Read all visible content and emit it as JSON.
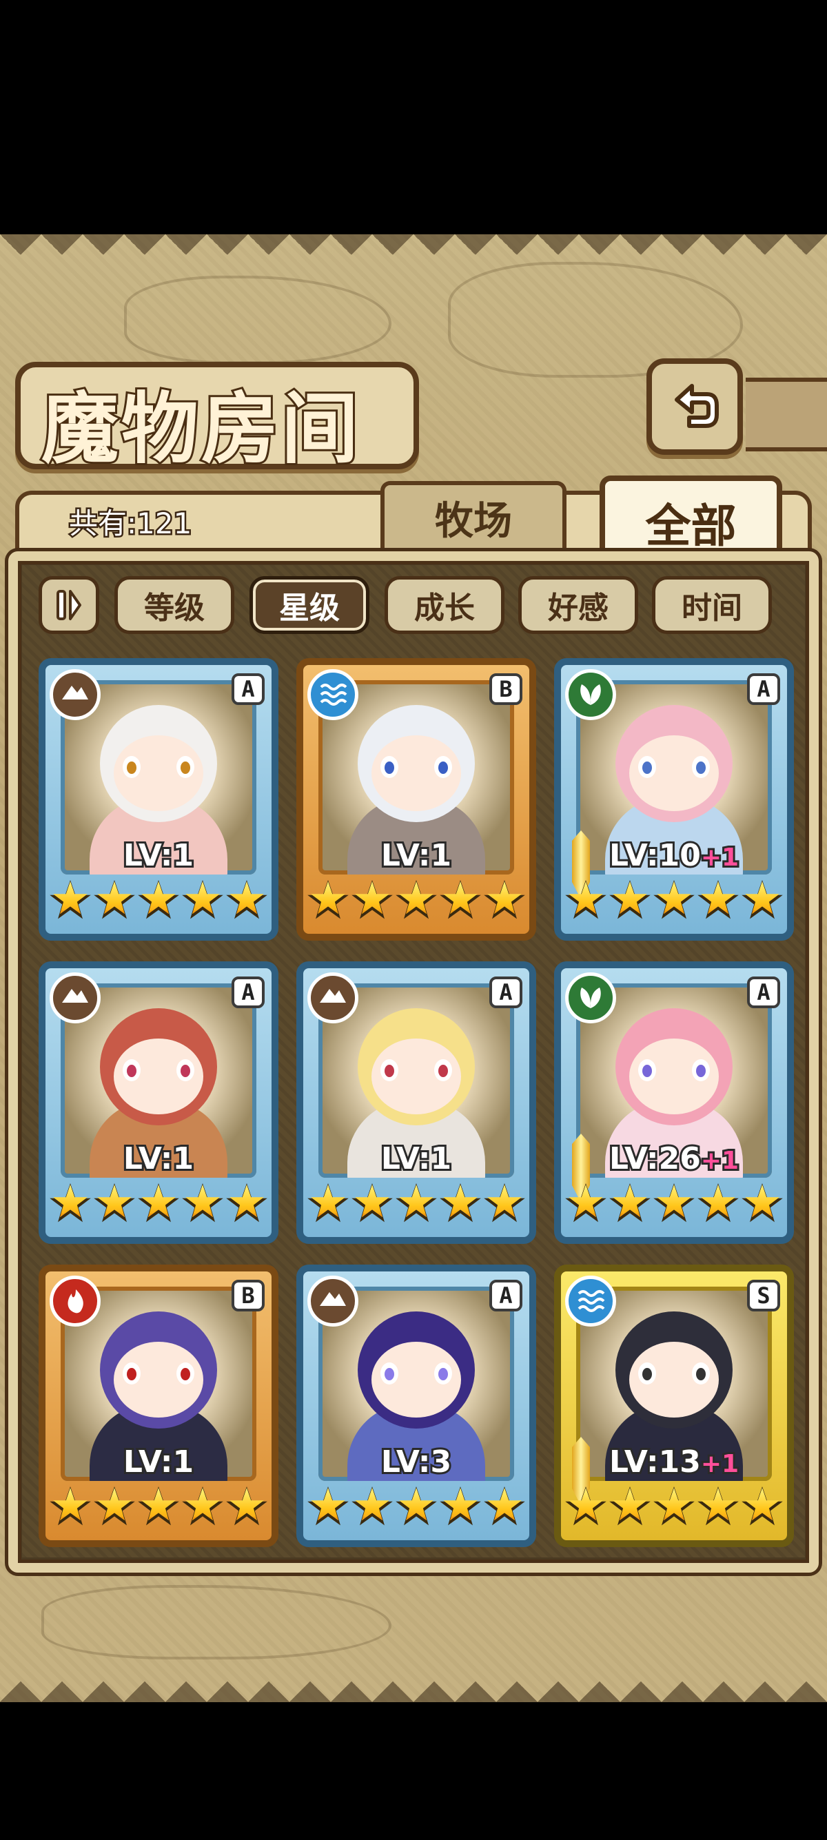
{
  "header": {
    "title": "魔物房间",
    "back_icon": "return-arrow-icon"
  },
  "tabs": {
    "count_label": "共有:121",
    "ranch": "牧场",
    "all": "全部",
    "active": "全部"
  },
  "sort": {
    "toggle_icon": "pause-sort-icon",
    "options": [
      "等级",
      "星级",
      "成长",
      "好感",
      "时间"
    ],
    "active": "星级"
  },
  "cards": [
    {
      "element": "earth",
      "rank": "A",
      "level": "LV:1",
      "bonus": "",
      "stars": 5,
      "frame": "blue"
    },
    {
      "element": "water",
      "rank": "B",
      "level": "LV:1",
      "bonus": "",
      "stars": 5,
      "frame": "orange"
    },
    {
      "element": "wood",
      "rank": "A",
      "level": "LV:10",
      "bonus": "+1",
      "stars": 5,
      "frame": "blue"
    },
    {
      "element": "earth",
      "rank": "A",
      "level": "LV:1",
      "bonus": "",
      "stars": 5,
      "frame": "blue"
    },
    {
      "element": "earth",
      "rank": "A",
      "level": "LV:1",
      "bonus": "",
      "stars": 5,
      "frame": "blue"
    },
    {
      "element": "wood",
      "rank": "A",
      "level": "LV:26",
      "bonus": "+1",
      "stars": 5,
      "frame": "blue"
    },
    {
      "element": "fire",
      "rank": "B",
      "level": "LV:1",
      "bonus": "",
      "stars": 5,
      "frame": "orange"
    },
    {
      "element": "earth",
      "rank": "A",
      "level": "LV:3",
      "bonus": "",
      "stars": 5,
      "frame": "blue"
    },
    {
      "element": "water",
      "rank": "S",
      "level": "LV:13",
      "bonus": "+1",
      "stars": 5,
      "frame": "gold"
    }
  ]
}
